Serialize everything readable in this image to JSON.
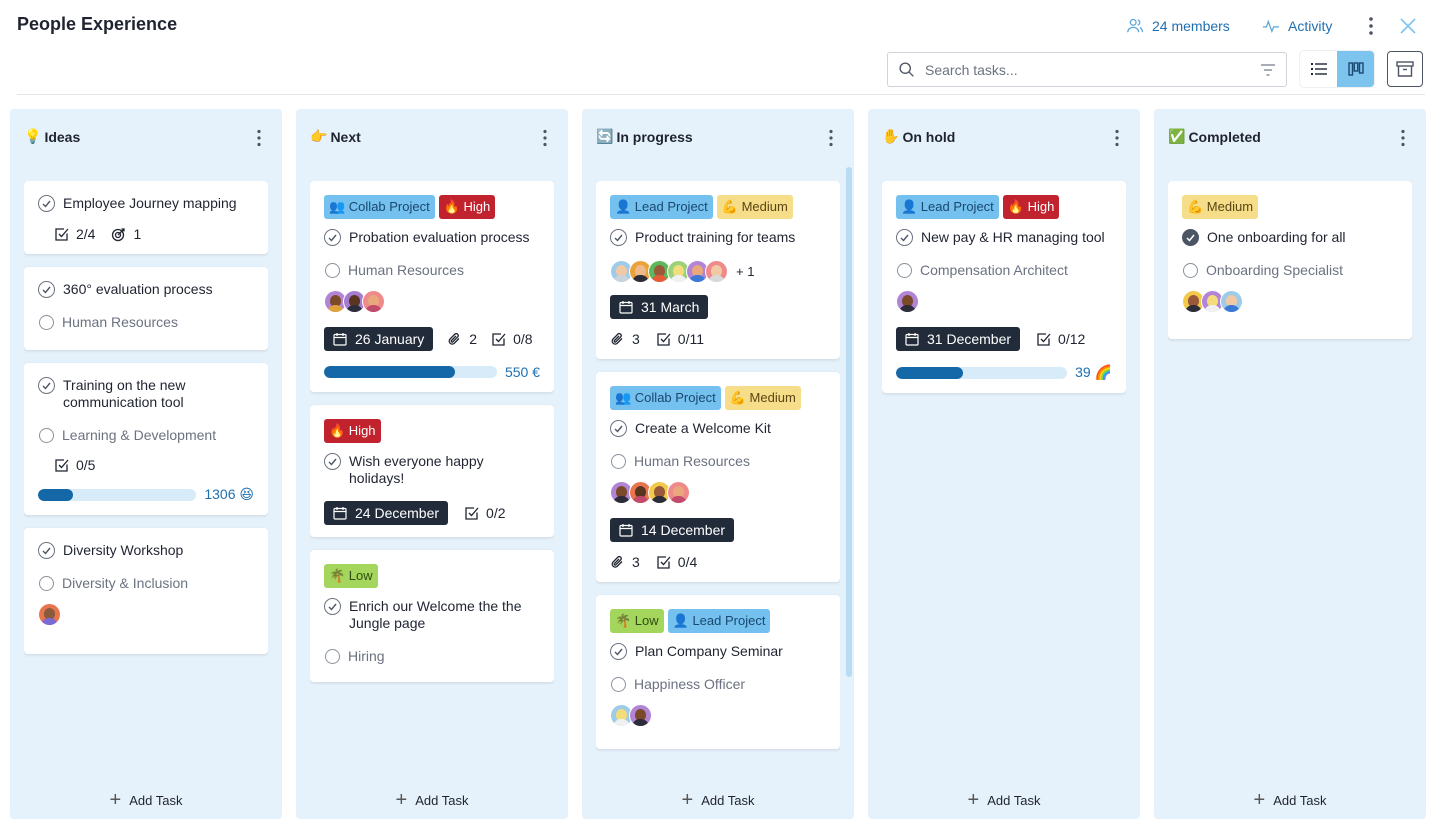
{
  "header": {
    "title": "People Experience",
    "members_label": "24 members",
    "activity_label": "Activity"
  },
  "toolbar": {
    "search_placeholder": "Search tasks..."
  },
  "add_task_label": "Add Task",
  "columns": [
    {
      "emoji": "💡",
      "title": "Ideas",
      "cards": [
        {
          "title": "Employee Journey mapping",
          "checklist": "2/4",
          "ideas_count": "1"
        },
        {
          "title": "360° evaluation process",
          "assignee": "Human Resources"
        },
        {
          "title": "Training on the new communication tool",
          "assignee": "Learning & Development",
          "checklist": "0/5",
          "progress": {
            "fraction": 0.22,
            "value": "1306 😆"
          }
        },
        {
          "title": "Diversity Workshop",
          "assignee": "Diversity & Inclusion"
        }
      ]
    },
    {
      "emoji": "👉",
      "title": "Next",
      "cards": [
        {
          "tags": [
            "👥 Collab Project",
            "🔥 High"
          ],
          "title": "Probation evaluation process",
          "assignee": "Human Resources",
          "date": "26 January",
          "attachments": "2",
          "checklist": "0/8",
          "progress": {
            "fraction": 0.76,
            "value": "550 €"
          }
        },
        {
          "tags": [
            "🔥 High"
          ],
          "title": "Wish everyone happy holidays!",
          "date": "24 December",
          "checklist": "0/2"
        },
        {
          "tags": [
            "🌴 Low"
          ],
          "title": "Enrich our Welcome the the Jungle page",
          "assignee": "Hiring"
        }
      ]
    },
    {
      "emoji": "🔄",
      "title": "In progress",
      "cards": [
        {
          "tags": [
            "👤 Lead Project",
            "💪 Medium"
          ],
          "title": "Product training for teams",
          "more_avatars": "+ 1",
          "date": "31 March",
          "attachments": "3",
          "checklist": "0/11"
        },
        {
          "tags": [
            "👥 Collab Project",
            "💪 Medium"
          ],
          "title": "Create a Welcome Kit",
          "assignee": "Human Resources",
          "date": "14 December",
          "attachments": "3",
          "checklist": "0/4"
        },
        {
          "tags": [
            "🌴 Low",
            "👤 Lead Project"
          ],
          "title": "Plan Company Seminar",
          "assignee": "Happiness Officer"
        }
      ]
    },
    {
      "emoji": "✋",
      "title": "On hold",
      "cards": [
        {
          "tags": [
            "👤 Lead Project",
            "🔥 High"
          ],
          "title": "New pay & HR managing tool",
          "assignee": "Compensation Architect",
          "date": "31 December",
          "checklist": "0/12",
          "progress": {
            "fraction": 0.39,
            "value": "39 🌈"
          }
        }
      ]
    },
    {
      "emoji": "✅",
      "title": "Completed",
      "cards": [
        {
          "tags": [
            "💪 Medium"
          ],
          "title": "One onboarding for all",
          "assignee": "Onboarding Specialist"
        }
      ]
    }
  ],
  "colors": {
    "accent": "#7cc3ee",
    "link": "#1f6fb0",
    "column_bg": "#e6f2fb",
    "high": "#c0232e",
    "medium": "#f6dd89",
    "low": "#a4d65e",
    "project": "#74c0ee",
    "date_bg": "#222b3a",
    "progress": "#1568a8"
  }
}
